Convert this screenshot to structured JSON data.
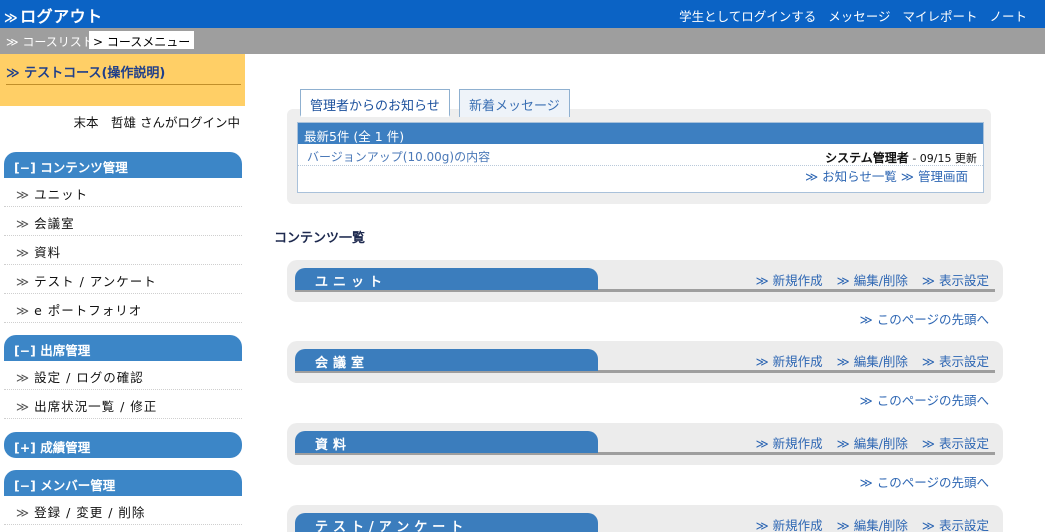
{
  "header": {
    "logout": "ログアウト",
    "nav": [
      "学生としてログインする",
      "メッセージ",
      "マイレポート",
      "ノート"
    ]
  },
  "breadcrumb": {
    "course_list": "コースリスト",
    "course_menu": "コースメニュー"
  },
  "sidebar": {
    "course_title": "テストコース(操作説明)",
    "login_text": "末本　哲雄 さんがログイン中",
    "sections": [
      {
        "label": "[−] コンテンツ管理",
        "items": [
          "ユニット",
          "会議室",
          "資料",
          "テスト / アンケート",
          "e ポートフォリオ"
        ]
      },
      {
        "label": "[−] 出席管理",
        "items": [
          "設定 / ログの確認",
          "出席状況一覧 / 修正"
        ]
      },
      {
        "label": "[+] 成績管理",
        "items": []
      },
      {
        "label": "[−] メンバー管理",
        "items": [
          "登録 / 変更 / 削除"
        ]
      }
    ]
  },
  "notices": {
    "tabs": [
      "管理者からのお知らせ",
      "新着メッセージ"
    ],
    "header": "最新5件 (全 1 件)",
    "rows": [
      {
        "title": "バージョンアップ(10.00g)の内容",
        "author": "システム管理者",
        "date": " - 09/15 更新"
      }
    ],
    "links": [
      "お知らせ一覧",
      "管理画面"
    ]
  },
  "contents": {
    "title": "コンテンツ一覧",
    "panels": [
      {
        "name": "ユニット"
      },
      {
        "name": "会議室"
      },
      {
        "name": "資料"
      },
      {
        "name": "テスト/アンケート"
      }
    ],
    "actions": [
      "新規作成",
      "編集/削除",
      "表示設定"
    ],
    "page_top": "このページの先頭へ"
  }
}
